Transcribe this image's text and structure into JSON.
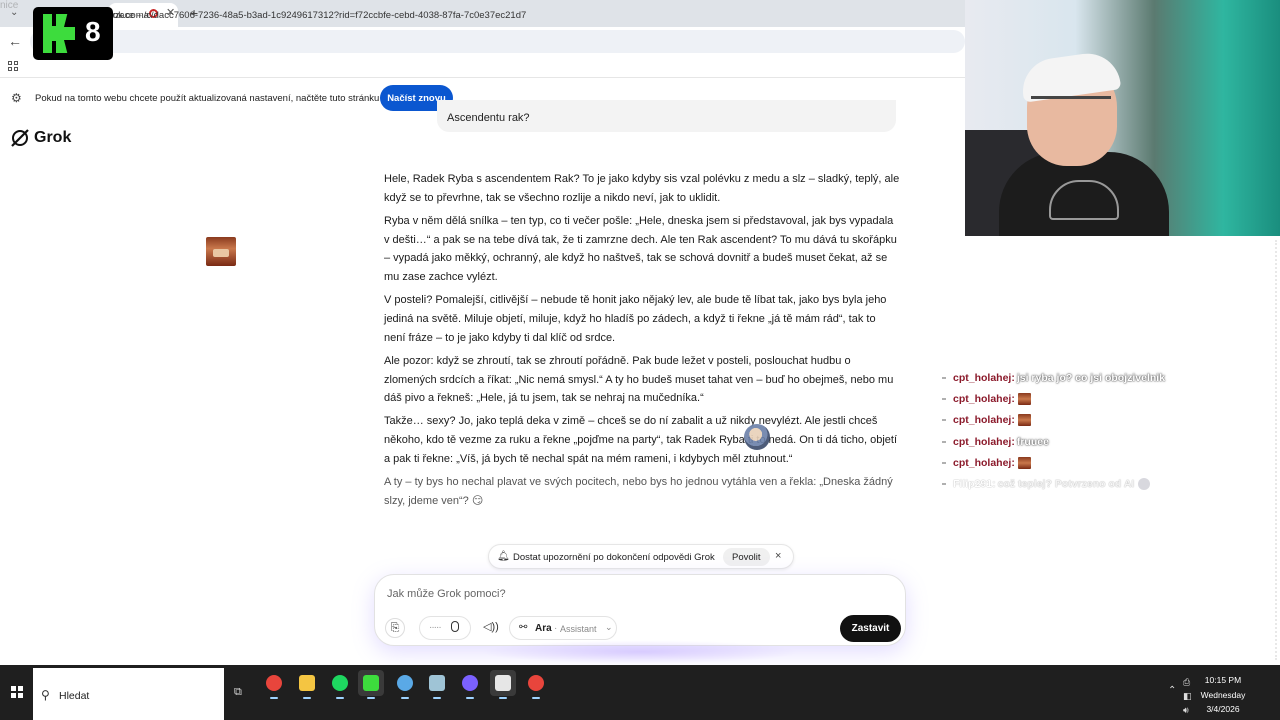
{
  "browser": {
    "corner_text": "nice",
    "tab_title": "rzace – a",
    "url": "ok.com/c/dacc7606-7236-48a5-b3ad-1c9249617312?rid=f72ccbfe-cebd-4038-87fa-7c0e37ec21d7"
  },
  "infobar": {
    "message": "Pokud na tomto webu chcete použít aktualizovaná nastavení, načtěte tuto stránku znovu",
    "button": "Načíst znovu"
  },
  "overlay_logo": {
    "number": "8"
  },
  "grok": {
    "brand": "Grok",
    "user_message_tail": "Ascendentu rak?",
    "answer": [
      "Hele, Radek Ryba s ascendentem Rak? To je jako kdyby sis vzal polévku z medu a slz – sladký, teplý, ale když se to převrhne, tak se všechno rozlije a nikdo neví, jak to uklidit.",
      "Ryba v něm dělá snílka – ten typ, co ti večer pošle: „Hele, dneska jsem si představoval, jak bys vypadala v dešti…“ a pak se na tebe dívá tak, že ti zamrzne dech. Ale ten Rak ascendent? To mu dává tu skořápku – vypadá jako měkký, ochranný, ale když ho naštveš, tak se schová dovnitř a budeš muset čekat, až se mu zase zachce vylézt.",
      "V posteli? Pomalejší, citlivější – nebude tě honit jako nějaký lev, ale bude tě líbat tak, jako bys byla jeho jediná na světě. Miluje objetí, miluje, když ho hladíš po zádech, a když ti řekne „já tě mám rád“, tak to není fráze – to je jako kdyby ti dal klíč od srdce.",
      "Ale pozor: když se zhroutí, tak se zhroutí pořádně. Pak bude ležet v posteli, poslouchat hudbu o zlomených srdcích a říkat: „Nic nemá smysl.“ A ty ho budeš muset tahat ven – buď ho obejmeš, nebo mu dáš pivo a řekneš: „Hele, já tu jsem, tak se nehraj na mučedníka.“",
      "Takže… sexy? Jo, jako teplá deka v zimě – chceš se do ní zabalit a už nikdy nevylézt. Ale jestli chceš někoho, kdo tě vezme za ruku a řekne „pojďme na party“, tak Radek Ryba ti to nedá. On ti dá ticho, objetí a pak ti řekne: „Víš, já bych tě nechal spát na mém rameni, i kdybych měl ztuhnout.“",
      "A ty – ty bys ho nechal plavat ve svých pocitech, nebo bys ho jednou vytáhla ven a řekla: „Dneska žádný slzy, jdeme ven“? 😏"
    ],
    "notification": {
      "text": "Dostat upozornění po dokončení odpovědi Grok",
      "allow": "Povolit",
      "close": "×"
    },
    "composer": {
      "placeholder": "Jak může Grok pomoci?",
      "voice_dots": "·····",
      "model_name": "Ara",
      "model_sep": "·",
      "model_mode": "Assistant",
      "stop": "Zastavit"
    }
  },
  "chat": [
    {
      "user": "cpt_holahej:",
      "message": "jsi ryba jo? co jsi obojzivelnik",
      "emote": false,
      "faded": false
    },
    {
      "user": "cpt_holahej:",
      "message": "",
      "emote": true,
      "faded": false
    },
    {
      "user": "cpt_holahej:",
      "message": "",
      "emote": true,
      "faded": false
    },
    {
      "user": "cpt_holahej:",
      "message": "fruuee",
      "emote": false,
      "faded": false
    },
    {
      "user": "cpt_holahej:",
      "message": "",
      "emote": true,
      "faded": false
    },
    {
      "user": "Filip291:",
      "message": "což teplej? Potvrzeno od AI",
      "emote": false,
      "sticker": true,
      "faded": true
    }
  ],
  "taskbar": {
    "search": "Hledat",
    "apps": [
      {
        "icon": "chrome-icon",
        "color": "#e8453c"
      },
      {
        "icon": "file-explorer-icon",
        "color": "#f4c542"
      },
      {
        "icon": "spotify-icon",
        "color": "#1ed760"
      },
      {
        "icon": "streaming-app-icon",
        "color": "#3ddc3d"
      },
      {
        "icon": "steam-icon",
        "color": "#5aa9e6"
      },
      {
        "icon": "notes-app-icon",
        "color": "#9fc4d6"
      },
      {
        "icon": "discord-icon",
        "color": "#7b61ff"
      },
      {
        "icon": "epic-games-icon",
        "color": "#e6e6e6"
      },
      {
        "icon": "chrome-icon",
        "color": "#e8453c"
      }
    ],
    "time": "10:15 PM",
    "day": "Wednesday",
    "date": "3/4/2026"
  },
  "colors": {
    "accent_blue": "#0b57d0",
    "chat_user": "#8b1a2b",
    "taskbar": "#1f1f1f"
  }
}
